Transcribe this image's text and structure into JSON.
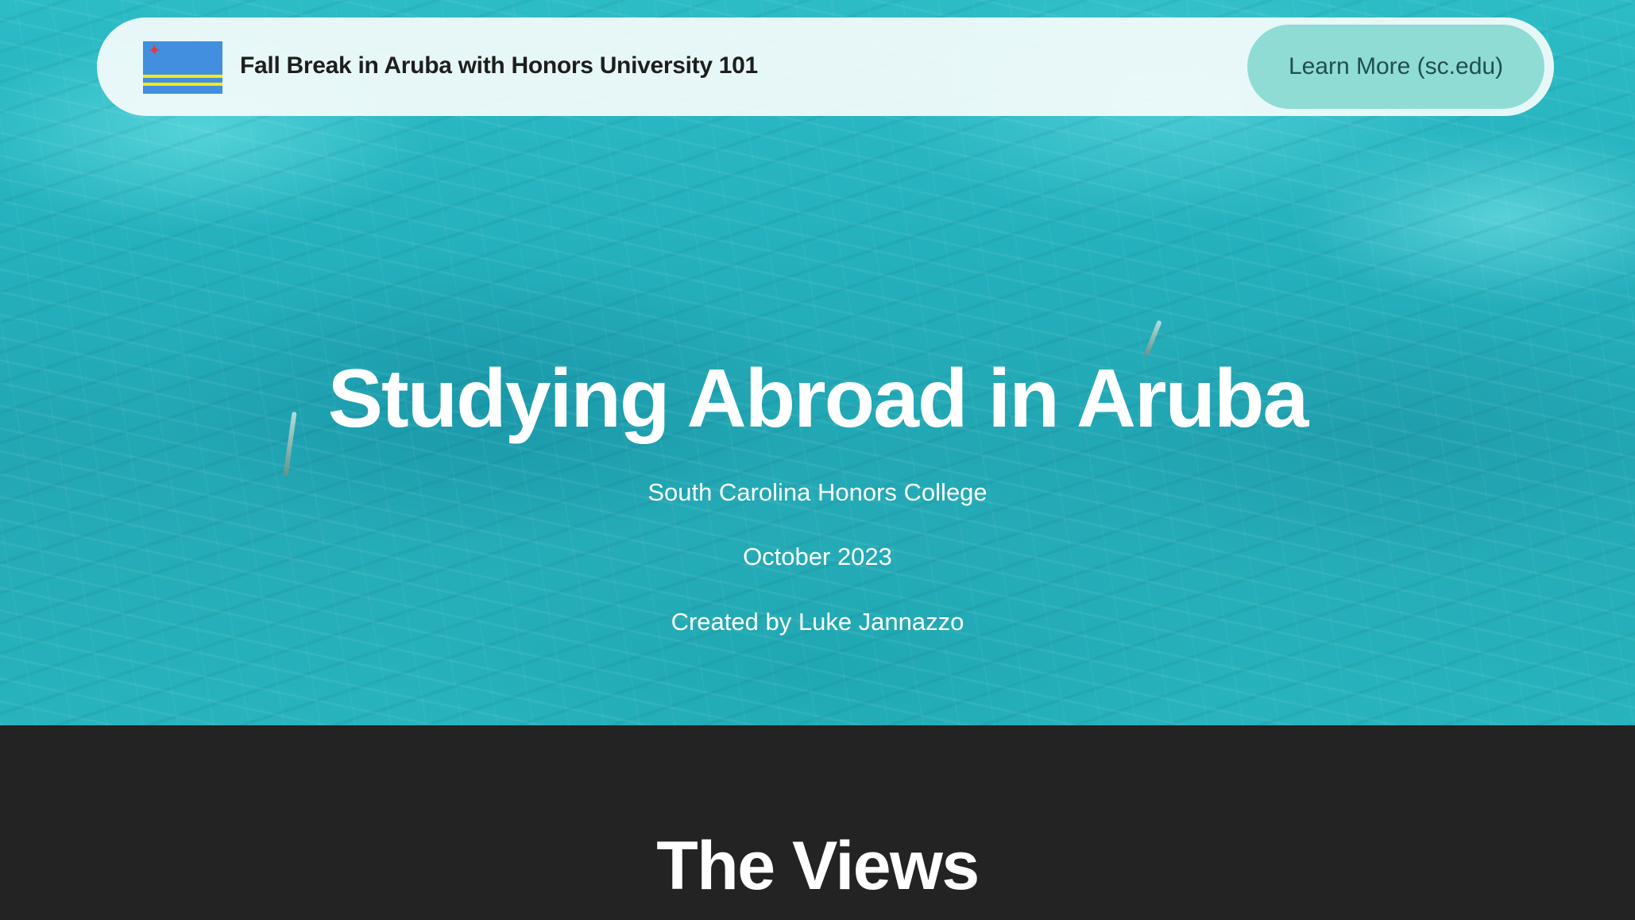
{
  "navbar": {
    "flag_icon": "aruba-flag-icon",
    "title": "Fall Break in Aruba with Honors University 101",
    "cta_label": "Learn More (sc.edu)"
  },
  "hero": {
    "title": "Studying Abroad in Aruba",
    "subtitle": "South Carolina Honors College",
    "date": "October 2023",
    "credit": "Created by Luke Jannazzo"
  },
  "section": {
    "title": "The Views"
  },
  "colors": {
    "water": "#25b0bd",
    "dark_background": "#232323",
    "cta_background": "#8fdcd5",
    "flag_blue": "#418fde",
    "flag_yellow": "#f9e814",
    "flag_red": "#ef3340"
  }
}
